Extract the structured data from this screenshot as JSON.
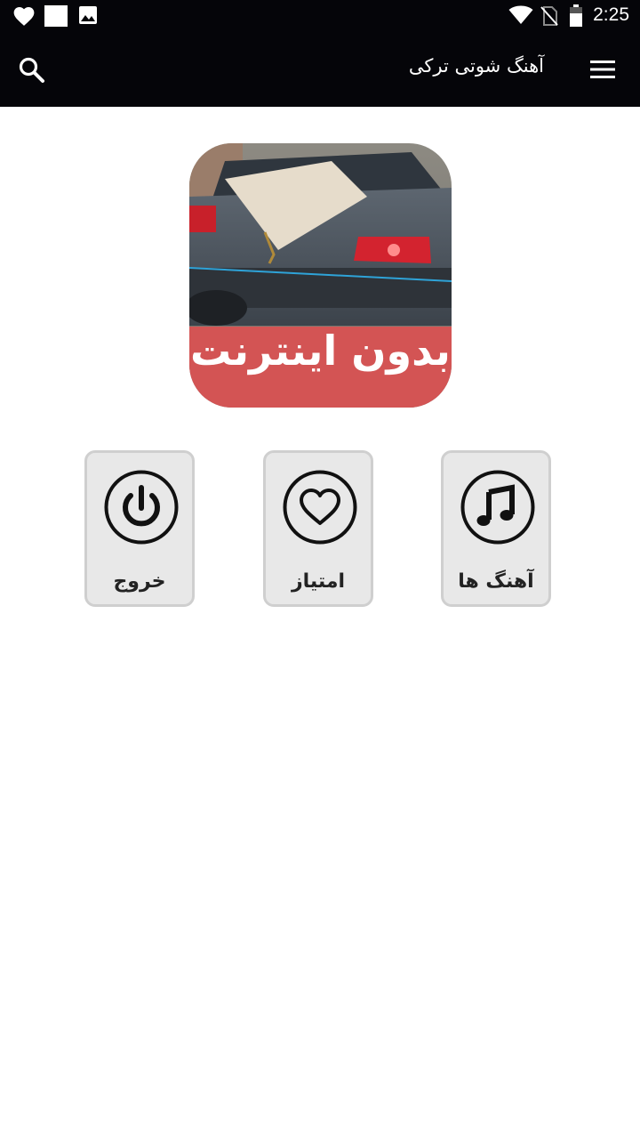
{
  "status_bar": {
    "time": "2:25",
    "left_icons": [
      "heart-icon",
      "square-notification-icon",
      "image-icon"
    ],
    "right_icons": [
      "wifi-icon",
      "no-sim-icon",
      "battery-icon"
    ]
  },
  "toolbar": {
    "title": "آهنگ شوتی ترکی",
    "search_icon": "search-icon",
    "menu_icon": "hamburger-menu-icon"
  },
  "banner": {
    "label": "بدون اینترنت"
  },
  "tiles": [
    {
      "label": "آهنگ ها",
      "icon": "music-note-icon"
    },
    {
      "label": "امتیاز",
      "icon": "heart-outline-icon"
    },
    {
      "label": "خروج",
      "icon": "power-icon"
    }
  ],
  "colors": {
    "bar_background": "#050509",
    "tile_background": "#e8e8e8",
    "tile_border": "#cfcfcf",
    "banner_label_band": "#d35454"
  }
}
